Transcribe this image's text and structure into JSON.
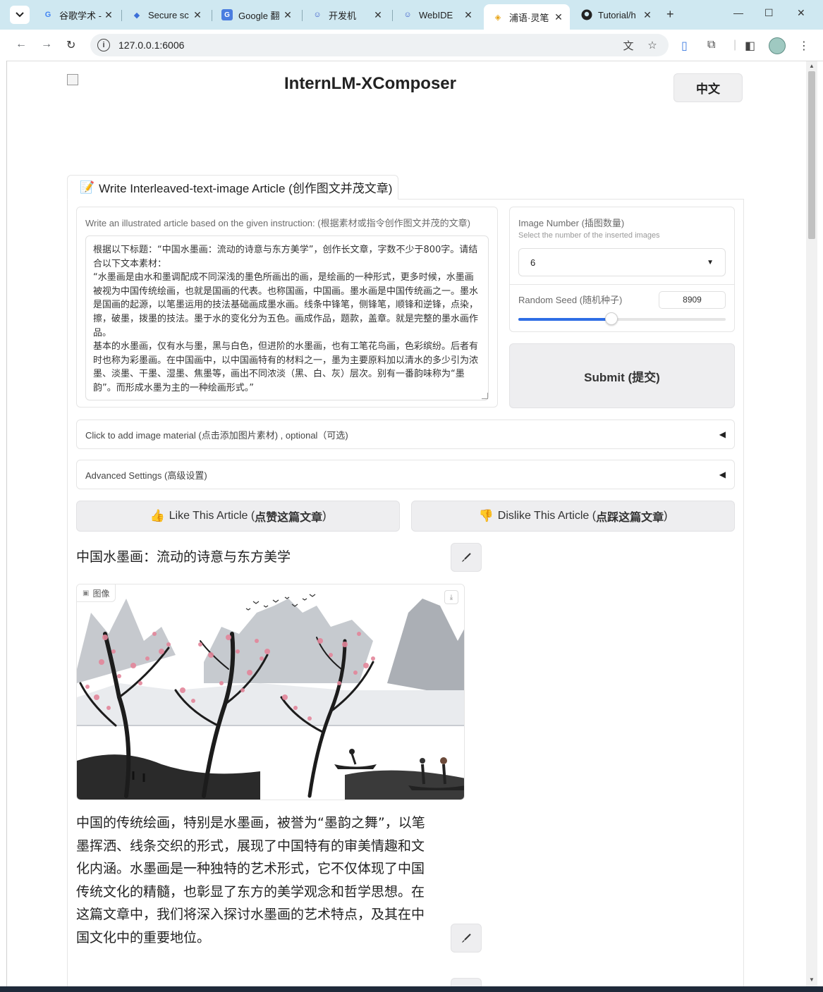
{
  "browser": {
    "tabs": [
      {
        "title": "谷歌学术 -",
        "icon": "google-icon"
      },
      {
        "title": "Secure sc",
        "icon": "cap-icon"
      },
      {
        "title": "Google 翻",
        "icon": "translate-icon"
      },
      {
        "title": "开发机",
        "icon": "robot-icon"
      },
      {
        "title": "WebIDE",
        "icon": "robot-icon"
      },
      {
        "title": "浦语·灵笔",
        "icon": "intern-icon"
      },
      {
        "title": "Tutorial/h",
        "icon": "github-icon"
      }
    ],
    "active_tab_index": 5,
    "url": "127.0.0.1:6006"
  },
  "header": {
    "app_title": "InternLM-XComposer",
    "lang_button": "中文"
  },
  "main_tab": {
    "label": "Write Interleaved-text-image Article (创作图文并茂文章)"
  },
  "instruction": {
    "label": "Write an illustrated article based on the given instruction: (根据素材或指令创作图文并茂的文章)",
    "text": "根据以下标题：“中国水墨画：流动的诗意与东方美学”，创作长文章，字数不少于800字。请结合以下文本素材：\n“水墨画是由水和墨调配成不同深浅的墨色所画出的画，是绘画的一种形式，更多时候，水墨画被视为中国传统绘画，也就是国画的代表。也称国画，中国画。墨水画是中国传统画之一。墨水是国画的起源，以笔墨运用的技法基础画成墨水画。线条中锋笔，侧锋笔，顺锋和逆锋，点染，擦，破墨，拨墨的技法。墨于水的变化分为五色。画成作品，题款，盖章。就是完整的墨水画作品。\n基本的水墨画，仅有水与墨，黑与白色，但进阶的水墨画，也有工笔花鸟画，色彩缤纷。后者有时也称为彩墨画。在中国画中，以中国画特有的材料之一，墨为主要原料加以清水的多少引为浓墨、淡墨、干墨、湿墨、焦墨等，画出不同浓淡（黑、白、灰）层次。别有一番韵味称为“墨韵”。而形成水墨为主的一种绘画形式。”"
  },
  "settings": {
    "image_number_label": "Image Number (插图数量)",
    "image_number_sub": "Select the number of the inserted images",
    "image_number_value": "6",
    "seed_label": "Random Seed (随机种子)",
    "seed_value": "8909",
    "seed_fraction": 0.45
  },
  "submit": {
    "label": "Submit (提交)"
  },
  "accordions": {
    "image_material": "Click to add image material (点击添加图片素材) , optional（可选)",
    "advanced": "Advanced Settings (高级设置)"
  },
  "votes": {
    "like_prefix": "Like This Article (",
    "like_bold": "点赞这篇文章",
    "like_suffix": ")",
    "dislike_prefix": "Dislike This Article (",
    "dislike_bold": "点踩这篇文章",
    "dislike_suffix": ")"
  },
  "article": {
    "title": "中国水墨画：流动的诗意与东方美学",
    "image_label": "图像",
    "paragraph": "中国的传统绘画，特别是水墨画，被誉为“墨韵之舞”，以笔墨挥洒、线条交织的形式，展现了中国特有的审美情趣和文化内涵。水墨画是一种独特的艺术形式，它不仅体现了中国传统文化的精髓，也彰显了东方的美学观念和哲学思想。在这篇文章中，我们将深入探讨水墨画的艺术特点，及其在中国文化中的重要地位。"
  },
  "colors": {
    "tabbar": "#cfe8f1",
    "slider": "#2f6ee5",
    "blossom": "#e3869a"
  }
}
